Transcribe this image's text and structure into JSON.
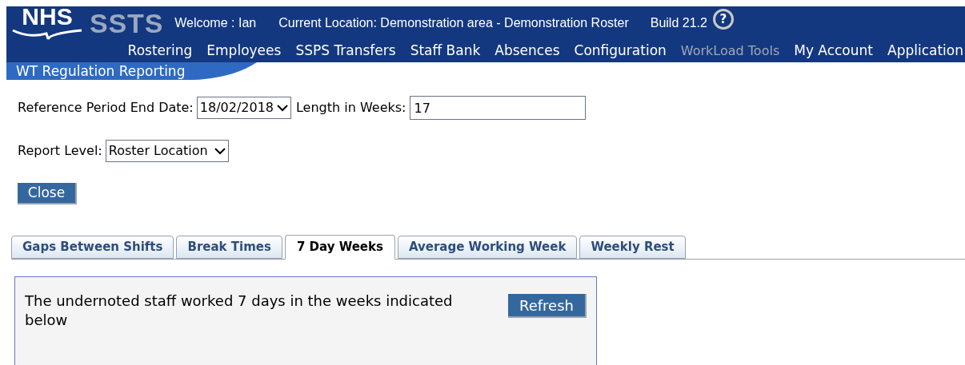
{
  "header": {
    "logo": "NHS",
    "product": "SSTS",
    "welcome": "Welcome : Ian",
    "location": "Current Location: Demonstration area - Demonstration Roster",
    "build": "Build 21.2",
    "help": "?"
  },
  "menu": [
    {
      "label": "Rostering",
      "disabled": false
    },
    {
      "label": "Employees",
      "disabled": false
    },
    {
      "label": "SSPS Transfers",
      "disabled": false
    },
    {
      "label": "Staff Bank",
      "disabled": false
    },
    {
      "label": "Absences",
      "disabled": false
    },
    {
      "label": "Configuration",
      "disabled": false
    },
    {
      "label": "WorkLoad Tools",
      "disabled": true
    },
    {
      "label": "My Account",
      "disabled": false
    },
    {
      "label": "Application",
      "disabled": false
    }
  ],
  "page_title": "WT Regulation Reporting",
  "form": {
    "end_date_label": "Reference Period End Date:",
    "end_date": "18/02/2018",
    "length_label": "Length in Weeks:",
    "length": "17",
    "level_label": "Report Level:",
    "level": "Roster Location"
  },
  "close_button": "Close",
  "tabs": [
    {
      "label": "Gaps Between Shifts",
      "selected": false
    },
    {
      "label": "Break Times",
      "selected": false
    },
    {
      "label": "7 Day Weeks",
      "selected": true
    },
    {
      "label": "Average Working Week",
      "selected": false
    },
    {
      "label": "Weekly Rest",
      "selected": false
    }
  ],
  "panel": {
    "message": "The undernoted staff worked 7 days in the weeks indicated below",
    "refresh_button": "Refresh"
  }
}
